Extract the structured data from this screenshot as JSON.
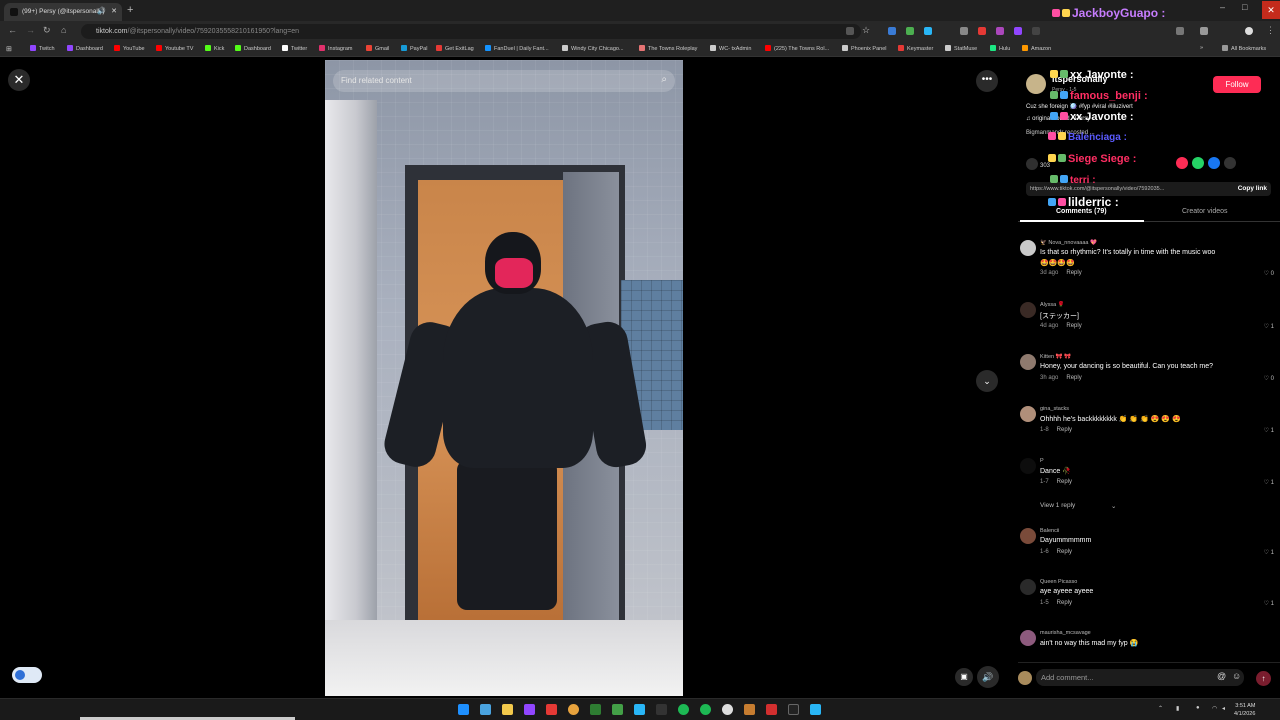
{
  "browser": {
    "tab_title": "(99+) Persy (@itspersonally)",
    "url_host": "tiktok.com",
    "url_path": "/@itspersonally/video/7592035558210161950?lang=en",
    "new_tab": "+",
    "window_controls": [
      "–",
      "□",
      "✕"
    ],
    "bookmarks": [
      {
        "label": "Twitch",
        "color": "#9146ff"
      },
      {
        "label": "Dashboard",
        "color": "#9146ff"
      },
      {
        "label": "YouTube",
        "color": "#ff0000"
      },
      {
        "label": "Youtube TV",
        "color": "#ff0000"
      },
      {
        "label": "Kick",
        "color": "#53fc18"
      },
      {
        "label": "Dashboard",
        "color": "#53fc18"
      },
      {
        "label": "Twitter",
        "color": "#ffffff"
      },
      {
        "label": "Instagram",
        "color": "#e1306c"
      },
      {
        "label": "Gmail",
        "color": "#ea4335"
      },
      {
        "label": "PayPal",
        "color": "#179bd7"
      },
      {
        "label": "Get ExitLag",
        "color": "#e53935"
      },
      {
        "label": "FanDuel | Daily Fant...",
        "color": "#1493ff"
      },
      {
        "label": "Windy City Chicago...",
        "color": "#cccccc"
      },
      {
        "label": "The Towns Roleplay",
        "color": "#e57373"
      },
      {
        "label": "WC- txAdmin",
        "color": "#cccccc"
      },
      {
        "label": "(225) The Towns Rol...",
        "color": "#ff0000"
      },
      {
        "label": "Phoenix Panel",
        "color": "#cccccc"
      },
      {
        "label": "Keymaster",
        "color": "#e53935"
      },
      {
        "label": "StatMuse",
        "color": "#cccccc"
      },
      {
        "label": "Hulu",
        "color": "#1ce783"
      },
      {
        "label": "Amazon",
        "color": "#ff9900"
      }
    ],
    "all_bookmarks": "All Bookmarks"
  },
  "video": {
    "search_placeholder": "Find related content"
  },
  "post": {
    "author": "itspersonally",
    "author_meta": "Persy · 1-5",
    "follow_label": "Follow",
    "caption": "Cuz she foreign 🪩 #fyp #viral #liluzivert",
    "sound": "original sound - Persy",
    "recommendation": "Bigmanmandr recosted ...",
    "likes": "303",
    "link": "https://www.tiktok.com/@itspersonally/video/7592035...",
    "copy_link": "Copy link",
    "tab_comments": "Comments (79)",
    "tab_creator": "Creator videos"
  },
  "comments": [
    {
      "user": "🦅 Nova_nnovaaaa 💖",
      "text": "Is that so rhythmic? It's totally in time with the music woo",
      "extra": "🤩🤩🤩🤩",
      "time": "3d ago",
      "likes": "0",
      "avatar": "#c9c9c9"
    },
    {
      "user": "Alyssa 🌹",
      "text": "[ステッカー]",
      "time": "4d ago",
      "likes": "1",
      "avatar": "#3a2a25"
    },
    {
      "user": "Kitten 🎀 🎀",
      "text": "Honey, your dancing is so beautiful. Can you teach me?",
      "time": "3h ago",
      "likes": "0",
      "avatar": "#8f7a6e"
    },
    {
      "user": "gina_stacks",
      "text": "Ohhhh he's backkkkkkkk 👏 👏 👏 😍 😍 😍",
      "time": "1-8",
      "likes": "1",
      "avatar": "#b08f7a"
    },
    {
      "user": "P",
      "text": "Dance 🥀",
      "time": "1-7",
      "likes": "1",
      "avatar": "#0d0d0d"
    },
    {
      "user": "Balencii",
      "text": "Dayummmmmm",
      "time": "1-6",
      "likes": "1",
      "avatar": "#7a4b3a"
    },
    {
      "user": "Queen Picasso",
      "text": "aye ayeee ayeee",
      "time": "1-5",
      "likes": "1",
      "avatar": "#2a2a2a"
    },
    {
      "user": "maurisha_mcsavage",
      "text": "ain't no way this mad my fyp 😭",
      "time": "",
      "likes": "",
      "avatar": "#8d5a7d"
    }
  ],
  "view_reply": "View 1 reply",
  "reply_label": "Reply",
  "add_comment_placeholder": "Add comment...",
  "stream_chat": [
    {
      "name": "JackboyGuapo :",
      "color": "#c77dff"
    },
    {
      "name": "xx Javonte :",
      "color": "#ffffff"
    },
    {
      "name": "famous_benji :",
      "color": "#ff2e63"
    },
    {
      "name": "xx Javonte :",
      "color": "#ffffff"
    },
    {
      "name": "Balenciaga :",
      "color": "#5b5bff"
    },
    {
      "name": "Siege Siege :",
      "color": "#ff2e63"
    },
    {
      "name": "terri :",
      "color": "#ff2e63"
    },
    {
      "name": "lilderric :",
      "color": "#ffffff"
    }
  ],
  "taskbar": {
    "time": "3:51 AM",
    "date": "4/1/2026"
  }
}
